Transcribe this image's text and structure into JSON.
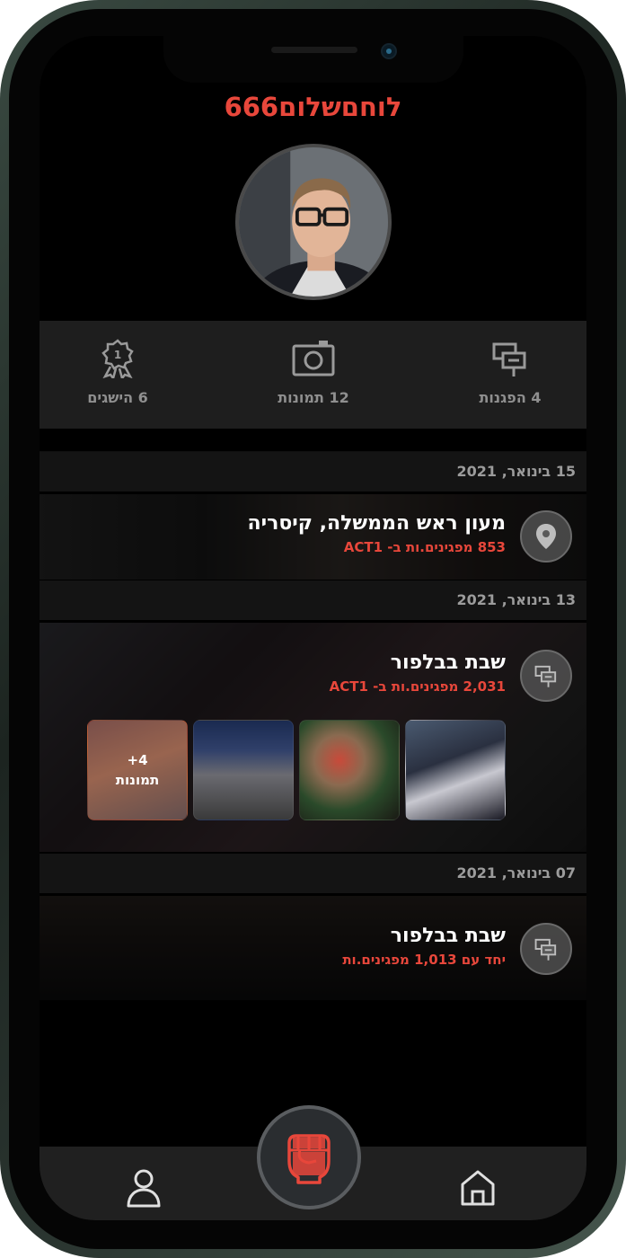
{
  "profile": {
    "username": "לוחםשלום666",
    "avatar_icon": "user-photo"
  },
  "stats": [
    {
      "icon": "protest-signs-icon",
      "label": "4 הפגנות"
    },
    {
      "icon": "camera-icon",
      "label": "12 תמונות"
    },
    {
      "icon": "award-badge-icon",
      "label": "6 הישגים"
    }
  ],
  "feed": [
    {
      "date": "15 בינואר, 2021",
      "icon": "location-pin-icon",
      "title": "מעון ראש הממשלה, קיסריה",
      "subtitle": "853 מפגינים.ות ב- ACT1"
    },
    {
      "date": "13 בינואר, 2021",
      "icon": "protest-signs-icon",
      "title": "שבת בבלפור",
      "subtitle": "2,031 מפגינים.ות ב- ACT1",
      "more_photos": {
        "count": "+4",
        "label": "תמונות"
      }
    },
    {
      "date": "07 בינואר, 2021",
      "icon": "protest-signs-icon",
      "title": "שבת בבלפור",
      "subtitle": "יחד עם 1,013 מפגינים.ות"
    }
  ],
  "nav": {
    "items": [
      "home-icon",
      "fist-icon",
      "user-icon"
    ]
  },
  "colors": {
    "accent": "#e8473b",
    "background": "#000000",
    "panel": "#1e1e1e"
  }
}
